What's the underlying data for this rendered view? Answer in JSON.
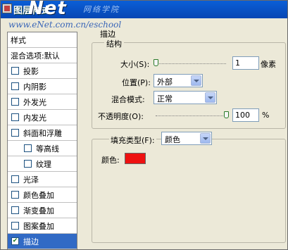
{
  "window": {
    "title": "图层样式",
    "watermark_logo": "Net",
    "watermark_cn": "网络学院",
    "watermark_url": "www.eNet.com.cn/eschool"
  },
  "sidebar": {
    "header": "样式",
    "blend": "混合选项:默认",
    "items": [
      {
        "label": "投影",
        "checked": false,
        "sub": false
      },
      {
        "label": "内阴影",
        "checked": false,
        "sub": false
      },
      {
        "label": "外发光",
        "checked": false,
        "sub": false
      },
      {
        "label": "内发光",
        "checked": false,
        "sub": false
      },
      {
        "label": "斜面和浮雕",
        "checked": false,
        "sub": false
      },
      {
        "label": "等高线",
        "checked": false,
        "sub": true
      },
      {
        "label": "纹理",
        "checked": false,
        "sub": true
      },
      {
        "label": "光泽",
        "checked": false,
        "sub": false
      },
      {
        "label": "颜色叠加",
        "checked": false,
        "sub": false
      },
      {
        "label": "渐变叠加",
        "checked": false,
        "sub": false
      },
      {
        "label": "图案叠加",
        "checked": false,
        "sub": false
      },
      {
        "label": "描边",
        "checked": true,
        "sub": false,
        "selected": true
      }
    ]
  },
  "stroke": {
    "title": "描边",
    "structure_title": "结构",
    "size_label": "大小(S):",
    "size_value": "1",
    "size_unit": "像素",
    "size_fraction": 0.0,
    "position_label": "位置(P):",
    "position_value": "外部",
    "blend_label": "混合模式:",
    "blend_value": "正常",
    "opacity_label": "不透明度(O):",
    "opacity_value": "100",
    "opacity_unit": "%",
    "opacity_fraction": 1.0,
    "fill_label": "填充类型(F):",
    "fill_value": "颜色",
    "color_label": "颜色:",
    "color_hex": "#ee1111"
  }
}
